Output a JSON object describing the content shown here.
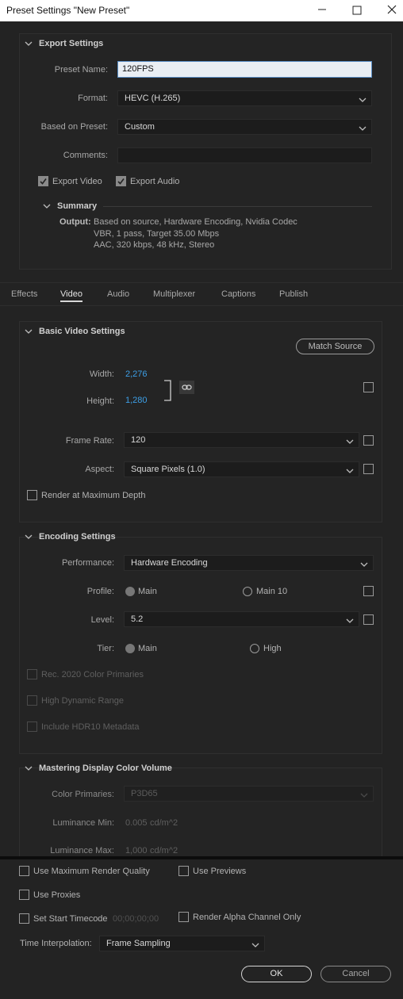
{
  "window": {
    "title": "Preset Settings \"New Preset\"",
    "minimize": "—",
    "maximize": "☐",
    "close": "✕"
  },
  "export_settings": {
    "header": "Export Settings",
    "preset_name_label": "Preset Name:",
    "preset_name_value": "120FPS",
    "format_label": "Format:",
    "format_value": "HEVC (H.265)",
    "based_on_label": "Based on Preset:",
    "based_on_value": "Custom",
    "comments_label": "Comments:",
    "comments_value": "",
    "export_video": "Export Video",
    "export_audio": "Export Audio",
    "summary_header": "Summary",
    "output_label": "Output:",
    "output_lines": [
      "Based on source, Hardware Encoding, Nvidia Codec",
      "VBR, 1 pass, Target 35.00 Mbps",
      "AAC, 320 kbps, 48 kHz, Stereo"
    ]
  },
  "tabs": [
    "Effects",
    "Video",
    "Audio",
    "Multiplexer",
    "Captions",
    "Publish"
  ],
  "active_tab": "Video",
  "basic_video": {
    "header": "Basic Video Settings",
    "match_source": "Match Source",
    "width_label": "Width:",
    "width_value": "2,276",
    "height_label": "Height:",
    "height_value": "1,280",
    "frame_rate_label": "Frame Rate:",
    "frame_rate_value": "120",
    "aspect_label": "Aspect:",
    "aspect_value": "Square Pixels (1.0)",
    "render_max_depth": "Render at Maximum Depth"
  },
  "encoding": {
    "header": "Encoding Settings",
    "performance_label": "Performance:",
    "performance_value": "Hardware Encoding",
    "profile_label": "Profile:",
    "profile_options": [
      "Main",
      "Main 10"
    ],
    "level_label": "Level:",
    "level_value": "5.2",
    "tier_label": "Tier:",
    "tier_options": [
      "Main",
      "High"
    ],
    "rec2020": "Rec. 2020 Color Primaries",
    "hdr": "High Dynamic Range",
    "hdr10": "Include HDR10 Metadata"
  },
  "mastering": {
    "header": "Mastering Display Color Volume",
    "color_primaries_label": "Color Primaries:",
    "color_primaries_value": "P3D65",
    "lum_min_label": "Luminance Min:",
    "lum_min_value": "0.005",
    "lum_min_unit": "cd/m^2",
    "lum_max_label": "Luminance Max:",
    "lum_max_value": "1,000",
    "lum_max_unit": "cd/m^2"
  },
  "bottom": {
    "use_max_render": "Use Maximum Render Quality",
    "use_previews": "Use Previews",
    "use_proxies": "Use Proxies",
    "set_start_tc": "Set Start Timecode",
    "timecode_value": "00;00;00;00",
    "render_alpha": "Render Alpha Channel Only",
    "time_interp_label": "Time Interpolation:",
    "time_interp_value": "Frame Sampling",
    "ok": "OK",
    "cancel": "Cancel"
  },
  "colors": {
    "background": "#232323",
    "accent_blue": "#3d9fe6",
    "title_bar": "#ffffff"
  }
}
